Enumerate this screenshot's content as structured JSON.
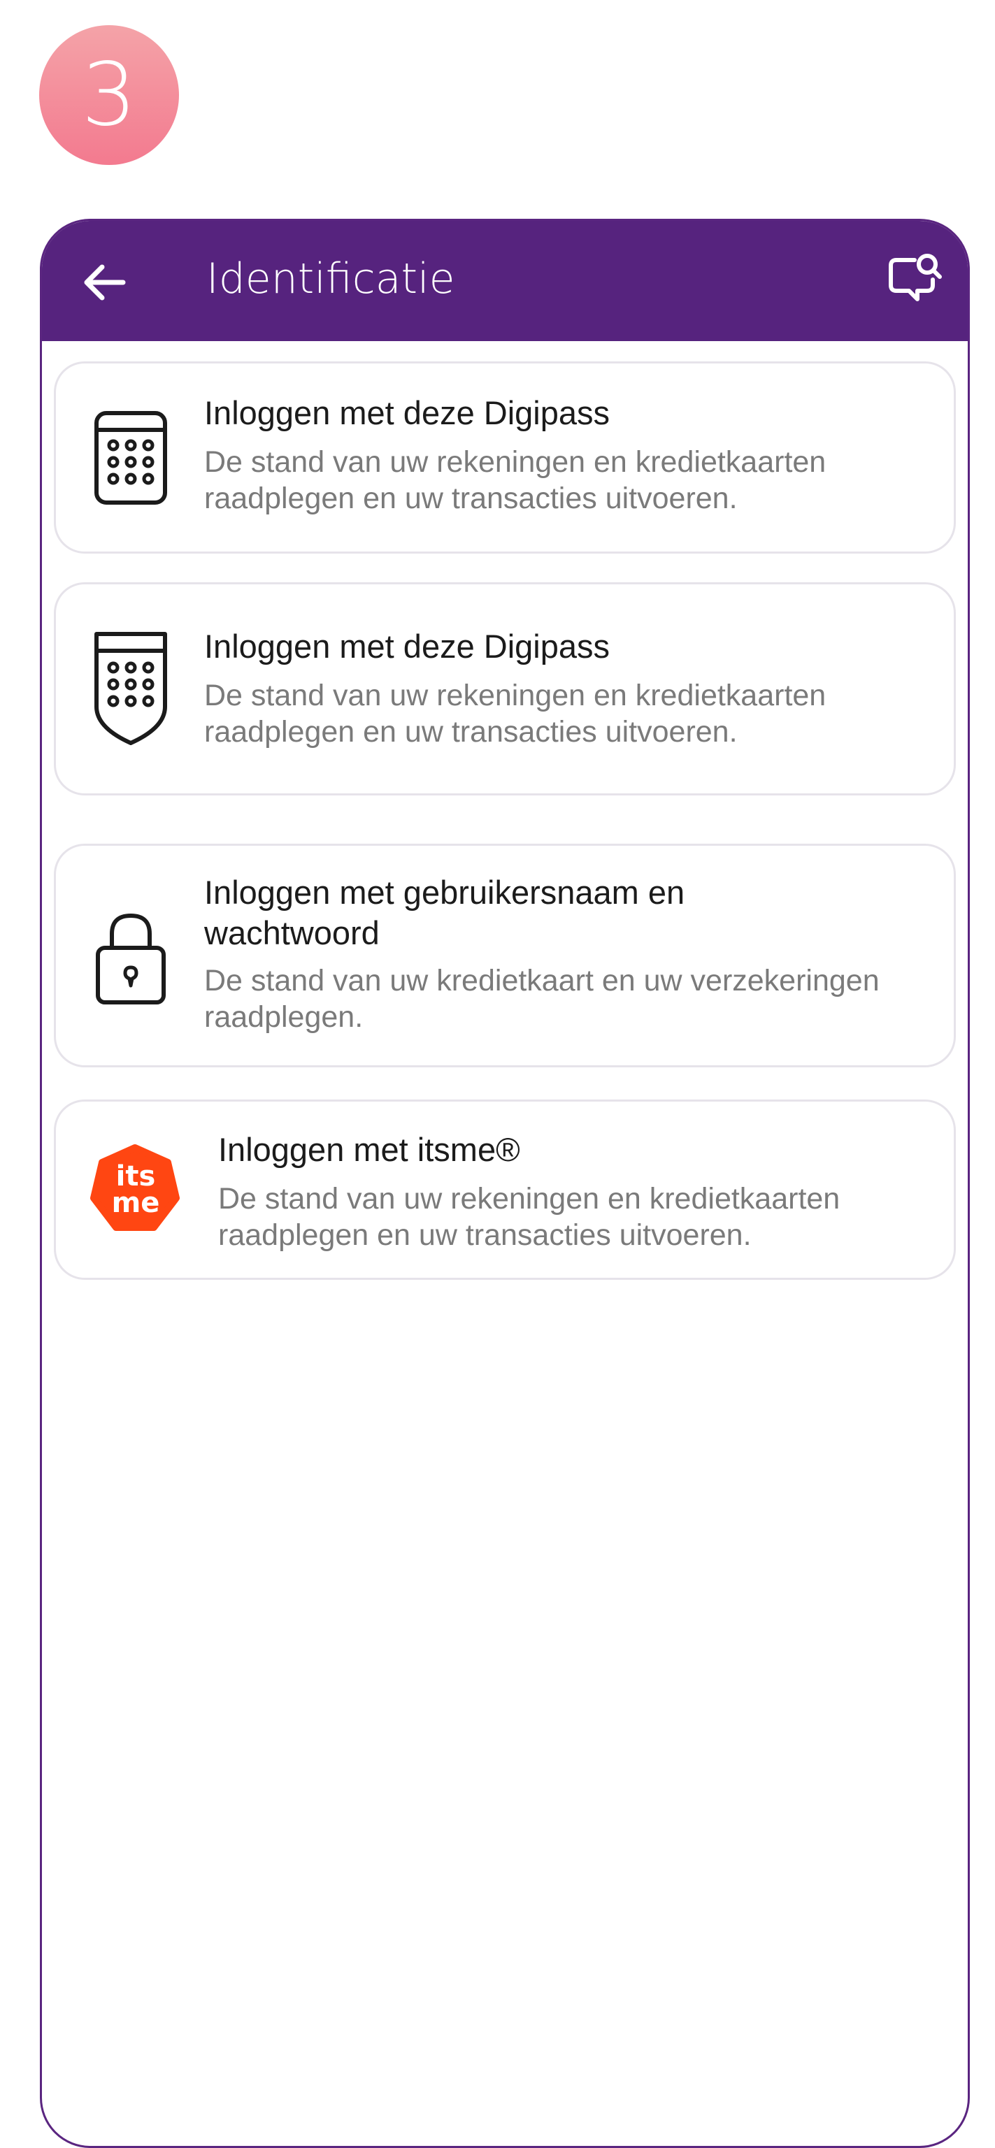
{
  "step": {
    "number": "3"
  },
  "header": {
    "title": "Identificatie",
    "back_icon": "arrow-left-icon",
    "help_icon": "chat-search-icon",
    "color": "#56237e"
  },
  "options": [
    {
      "icon": "digipass-keypad-icon",
      "title": "Inloggen met deze Digipass",
      "line1": "De stand van uw rekeningen en kredietkaarten",
      "line2": "raadplegen en uw transacties uitvoeren."
    },
    {
      "icon": "digipass-shield-icon",
      "title": "Inloggen met deze Digipass",
      "line1": "De stand van uw rekeningen en kredietkaarten",
      "line2": "raadplegen en uw transacties uitvoeren."
    },
    {
      "icon": "padlock-icon",
      "title_line1": "Inloggen met gebruikersnaam en",
      "title_line2": "wachtwoord",
      "line1": "De stand van uw kredietkaart en uw verzekeringen",
      "line2": "raadplegen."
    },
    {
      "icon": "itsme-logo-icon",
      "logo_text_top": "its",
      "logo_text_bottom": "me",
      "title": "Inloggen met itsme®",
      "line1": "De stand van uw rekeningen en kredietkaarten",
      "line2": "raadplegen en uw transacties uitvoeren.",
      "logo_color": "#ff4612"
    }
  ]
}
